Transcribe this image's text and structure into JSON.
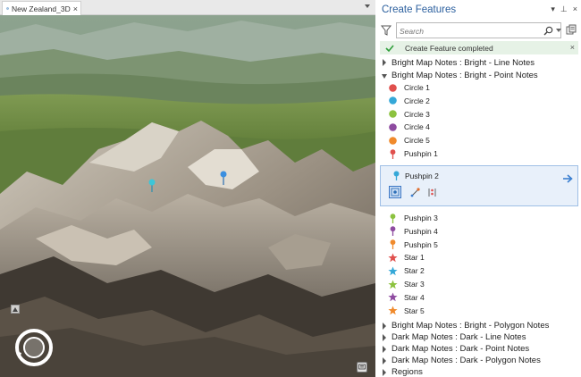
{
  "map_view": {
    "tab_title": "New Zealand_3D",
    "tab_close": "×"
  },
  "pane": {
    "title": "Create Features",
    "controls": {
      "menu": "▾",
      "pin": "⊥",
      "close": "×"
    },
    "search": {
      "placeholder": "Search"
    },
    "status": {
      "text": "Create Feature completed",
      "close": "×"
    },
    "groups": [
      {
        "label": "Bright Map Notes : Bright - Line Notes",
        "expanded": false
      },
      {
        "label": "Bright Map Notes : Bright - Point Notes",
        "expanded": true
      },
      {
        "label": "Bright Map Notes : Bright - Polygon Notes",
        "expanded": false
      },
      {
        "label": "Dark Map Notes : Dark - Line Notes",
        "expanded": false
      },
      {
        "label": "Dark Map Notes : Dark - Point Notes",
        "expanded": false
      },
      {
        "label": "Dark Map Notes : Dark - Polygon Notes",
        "expanded": false
      },
      {
        "label": "Regions",
        "expanded": false
      }
    ],
    "point_templates": [
      {
        "label": "Circle 1",
        "symbol": "circle",
        "color": "#e0504d"
      },
      {
        "label": "Circle 2",
        "symbol": "circle",
        "color": "#35a8d8"
      },
      {
        "label": "Circle 3",
        "symbol": "circle",
        "color": "#8cc23f"
      },
      {
        "label": "Circle 4",
        "symbol": "circle",
        "color": "#8e4ba0"
      },
      {
        "label": "Circle 5",
        "symbol": "circle",
        "color": "#f08a2c"
      },
      {
        "label": "Pushpin 1",
        "symbol": "pushpin",
        "color": "#e0504d"
      }
    ],
    "selected_template": {
      "label": "Pushpin 2",
      "symbol": "pushpin",
      "color": "#35a8d8"
    },
    "point_templates_after": [
      {
        "label": "Pushpin 3",
        "symbol": "pushpin",
        "color": "#8cc23f"
      },
      {
        "label": "Pushpin 4",
        "symbol": "pushpin",
        "color": "#8e4ba0"
      },
      {
        "label": "Pushpin 5",
        "symbol": "pushpin",
        "color": "#f08a2c"
      },
      {
        "label": "Star 1",
        "symbol": "star",
        "color": "#e0504d"
      },
      {
        "label": "Star 2",
        "symbol": "star",
        "color": "#35a8d8"
      },
      {
        "label": "Star 3",
        "symbol": "star",
        "color": "#8cc23f"
      },
      {
        "label": "Star 4",
        "symbol": "star",
        "color": "#8e4ba0"
      },
      {
        "label": "Star 5",
        "symbol": "star",
        "color": "#f08a2c"
      }
    ],
    "accent_color": "#2b5f9e"
  }
}
